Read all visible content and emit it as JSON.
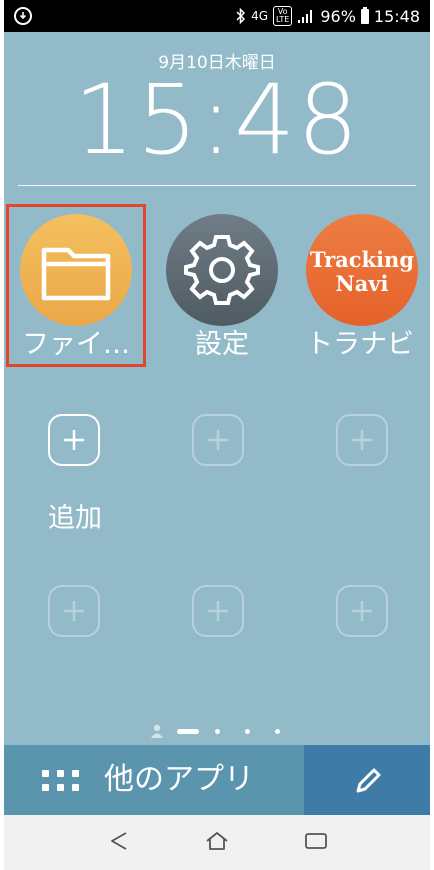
{
  "status_bar": {
    "left_icon": "download-notification-icon",
    "bluetooth_icon": "bluetooth-icon",
    "network": "4G",
    "volte": "VoLTE",
    "signal_icon": "signal-icon",
    "battery_percent": "96%",
    "battery_level": 0.96,
    "time": "15:48"
  },
  "lockscreen": {
    "date": "9月10日木曜日",
    "time": "15:48"
  },
  "apps": [
    {
      "label": "ファイ…",
      "icon": "folder-icon"
    },
    {
      "label": "設定",
      "icon": "gear-icon"
    },
    {
      "label": "トラナビ",
      "icon_text_line1": "Tracking",
      "icon_text_line2": "Navi"
    }
  ],
  "add_slot": {
    "label": "追加",
    "icon": "plus-icon"
  },
  "pager": {
    "page_count": 4,
    "current_page": 1
  },
  "bottom_bar": {
    "other_apps_label": "他のアプリ",
    "grid_icon": "apps-grid-icon",
    "edit_icon": "pencil-icon"
  },
  "nav_bar": {
    "back_icon": "back-icon",
    "home_icon": "home-icon",
    "recents_icon": "recents-icon"
  },
  "colors": {
    "background": "#93bac9",
    "highlight": "#e0472c",
    "folder": "#f0b454",
    "settings": "#5f6b74",
    "tracking_navi": "#e96f35",
    "other_apps_bar": "#5a95ad",
    "edit_bar": "#3f7ba7"
  }
}
